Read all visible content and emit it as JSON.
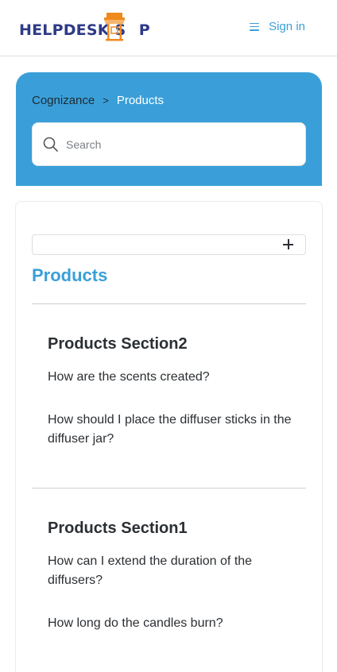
{
  "header": {
    "logo_text_left": "HELPDESK S",
    "logo_text_o": "O",
    "logo_text_right": "P",
    "logo_accent_color": "#f08a1c",
    "logo_primary_color": "#2e3a87",
    "menu_icon": "hamburger-icon",
    "signin_label": "Sign in"
  },
  "breadcrumb": {
    "home": "Cognizance",
    "separator": ">",
    "current": "Products"
  },
  "search": {
    "placeholder": "Search",
    "icon": "search-icon"
  },
  "main": {
    "title": "Products",
    "accent_color": "#3a9fd8",
    "sections": [
      {
        "title": "Products Section2",
        "articles": [
          "How are the scents created?",
          "How should I place the diffuser sticks in the diffuser jar?"
        ]
      },
      {
        "title": "Products Section1",
        "articles": [
          "How can I extend the duration of the diffusers?",
          "How long do the candles burn?"
        ]
      }
    ]
  }
}
